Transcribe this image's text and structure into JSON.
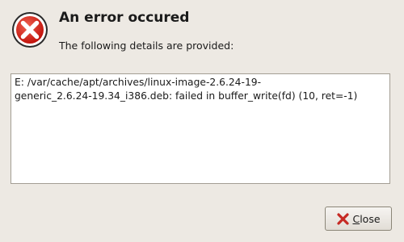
{
  "dialog": {
    "title": "An error occured",
    "subtitle": "The following details are provided:",
    "details": {
      "lines": [
        "E: /var/cache/apt/archives/linux-image-2.6.24-19-",
        "generic_2.6.24-19.34_i386.deb: failed in buffer_write(fd) (10, ret=-1)"
      ]
    },
    "buttons": {
      "close_label": "Close"
    },
    "icons": {
      "error": "error-icon",
      "close": "close-icon"
    },
    "colors": {
      "error_red": "#d3271f",
      "close_red": "#c62a24"
    }
  }
}
